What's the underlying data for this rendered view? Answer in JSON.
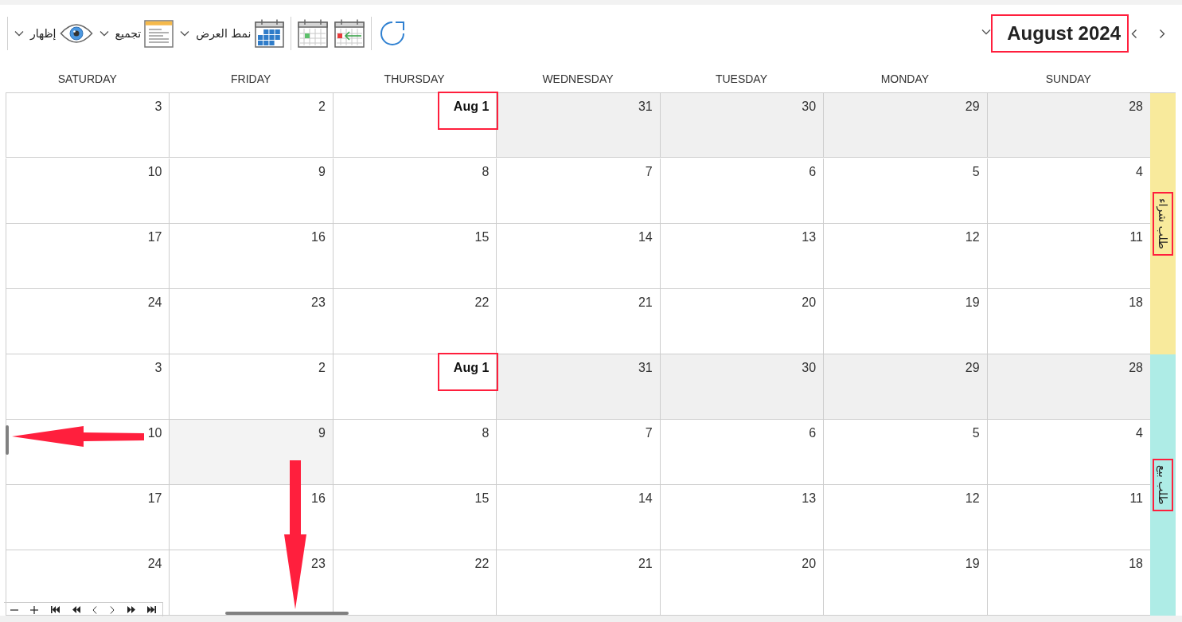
{
  "toolbar": {
    "month": {
      "title": "August 2024",
      "marked": true
    },
    "menus": [
      {
        "kind": "view-mode",
        "label": "نمط العرض"
      },
      {
        "kind": "group",
        "label": "تجميع"
      },
      {
        "kind": "show",
        "label": "إظهار"
      }
    ]
  },
  "calendar": {
    "day_headers": [
      "SUNDAY",
      "MONDAY",
      "TUESDAY",
      "WEDNESDAY",
      "THURSDAY",
      "FRIDAY",
      "SATURDAY"
    ],
    "groups": [
      {
        "label": "طلب شراء",
        "color": "#f8ea9c",
        "marked": true,
        "weeks": [
          [
            {
              "day": "28",
              "kind": "day",
              "outside": true,
              "selected": false,
              "marked": false
            },
            {
              "day": "29",
              "kind": "day",
              "outside": true,
              "selected": false,
              "marked": false
            },
            {
              "day": "30",
              "kind": "day",
              "outside": true,
              "selected": false,
              "marked": false
            },
            {
              "day": "31",
              "kind": "day",
              "outside": true,
              "selected": false,
              "marked": false
            },
            {
              "day": "Aug 1",
              "kind": "month-start",
              "outside": false,
              "selected": false,
              "marked": true
            },
            {
              "day": "2",
              "kind": "day",
              "outside": false,
              "selected": false,
              "marked": false
            },
            {
              "day": "3",
              "kind": "day",
              "outside": false,
              "selected": false,
              "marked": false
            }
          ],
          [
            {
              "day": "4",
              "kind": "day",
              "outside": false,
              "selected": false,
              "marked": false
            },
            {
              "day": "5",
              "kind": "day",
              "outside": false,
              "selected": false,
              "marked": false
            },
            {
              "day": "6",
              "kind": "day",
              "outside": false,
              "selected": false,
              "marked": false
            },
            {
              "day": "7",
              "kind": "day",
              "outside": false,
              "selected": false,
              "marked": false
            },
            {
              "day": "8",
              "kind": "day",
              "outside": false,
              "selected": false,
              "marked": false
            },
            {
              "day": "9",
              "kind": "day",
              "outside": false,
              "selected": false,
              "marked": false
            },
            {
              "day": "10",
              "kind": "day",
              "outside": false,
              "selected": false,
              "marked": false
            }
          ],
          [
            {
              "day": "11",
              "kind": "day",
              "outside": false,
              "selected": false,
              "marked": false
            },
            {
              "day": "12",
              "kind": "day",
              "outside": false,
              "selected": false,
              "marked": false
            },
            {
              "day": "13",
              "kind": "day",
              "outside": false,
              "selected": false,
              "marked": false
            },
            {
              "day": "14",
              "kind": "day",
              "outside": false,
              "selected": false,
              "marked": false
            },
            {
              "day": "15",
              "kind": "day",
              "outside": false,
              "selected": false,
              "marked": false
            },
            {
              "day": "16",
              "kind": "day",
              "outside": false,
              "selected": false,
              "marked": false
            },
            {
              "day": "17",
              "kind": "day",
              "outside": false,
              "selected": false,
              "marked": false
            }
          ],
          [
            {
              "day": "18",
              "kind": "day",
              "outside": false,
              "selected": false,
              "marked": false
            },
            {
              "day": "19",
              "kind": "day",
              "outside": false,
              "selected": false,
              "marked": false
            },
            {
              "day": "20",
              "kind": "day",
              "outside": false,
              "selected": false,
              "marked": false
            },
            {
              "day": "21",
              "kind": "day",
              "outside": false,
              "selected": false,
              "marked": false
            },
            {
              "day": "22",
              "kind": "day",
              "outside": false,
              "selected": false,
              "marked": false
            },
            {
              "day": "23",
              "kind": "day",
              "outside": false,
              "selected": false,
              "marked": false
            },
            {
              "day": "24",
              "kind": "day",
              "outside": false,
              "selected": false,
              "marked": false
            }
          ]
        ]
      },
      {
        "label": "طلب بيع",
        "color": "#aeece6",
        "marked": true,
        "weeks": [
          [
            {
              "day": "28",
              "kind": "day",
              "outside": true,
              "selected": false,
              "marked": false
            },
            {
              "day": "29",
              "kind": "day",
              "outside": true,
              "selected": false,
              "marked": false
            },
            {
              "day": "30",
              "kind": "day",
              "outside": true,
              "selected": false,
              "marked": false
            },
            {
              "day": "31",
              "kind": "day",
              "outside": true,
              "selected": false,
              "marked": false
            },
            {
              "day": "Aug 1",
              "kind": "month-start",
              "outside": false,
              "selected": false,
              "marked": true
            },
            {
              "day": "2",
              "kind": "day",
              "outside": false,
              "selected": false,
              "marked": false
            },
            {
              "day": "3",
              "kind": "day",
              "outside": false,
              "selected": false,
              "marked": false
            }
          ],
          [
            {
              "day": "4",
              "kind": "day",
              "outside": false,
              "selected": false,
              "marked": false
            },
            {
              "day": "5",
              "kind": "day",
              "outside": false,
              "selected": false,
              "marked": false
            },
            {
              "day": "6",
              "kind": "day",
              "outside": false,
              "selected": false,
              "marked": false
            },
            {
              "day": "7",
              "kind": "day",
              "outside": false,
              "selected": false,
              "marked": false
            },
            {
              "day": "8",
              "kind": "day",
              "outside": false,
              "selected": false,
              "marked": false
            },
            {
              "day": "9",
              "kind": "day",
              "outside": false,
              "selected": true,
              "marked": false
            },
            {
              "day": "10",
              "kind": "day",
              "outside": false,
              "selected": false,
              "marked": false
            }
          ],
          [
            {
              "day": "11",
              "kind": "day",
              "outside": false,
              "selected": false,
              "marked": false
            },
            {
              "day": "12",
              "kind": "day",
              "outside": false,
              "selected": false,
              "marked": false
            },
            {
              "day": "13",
              "kind": "day",
              "outside": false,
              "selected": false,
              "marked": false
            },
            {
              "day": "14",
              "kind": "day",
              "outside": false,
              "selected": false,
              "marked": false
            },
            {
              "day": "15",
              "kind": "day",
              "outside": false,
              "selected": false,
              "marked": false
            },
            {
              "day": "16",
              "kind": "day",
              "outside": false,
              "selected": false,
              "marked": false
            },
            {
              "day": "17",
              "kind": "day",
              "outside": false,
              "selected": false,
              "marked": false
            }
          ],
          [
            {
              "day": "18",
              "kind": "day",
              "outside": false,
              "selected": false,
              "marked": false
            },
            {
              "day": "19",
              "kind": "day",
              "outside": false,
              "selected": false,
              "marked": false
            },
            {
              "day": "20",
              "kind": "day",
              "outside": false,
              "selected": false,
              "marked": false
            },
            {
              "day": "21",
              "kind": "day",
              "outside": false,
              "selected": false,
              "marked": false
            },
            {
              "day": "22",
              "kind": "day",
              "outside": false,
              "selected": false,
              "marked": false
            },
            {
              "day": "23",
              "kind": "day",
              "outside": false,
              "selected": false,
              "marked": false
            },
            {
              "day": "24",
              "kind": "day",
              "outside": false,
              "selected": false,
              "marked": false
            }
          ]
        ]
      }
    ]
  },
  "scrollbars": {
    "vertical": {
      "pointed_at": true
    },
    "horizontal": {
      "pointed_at": true
    }
  }
}
